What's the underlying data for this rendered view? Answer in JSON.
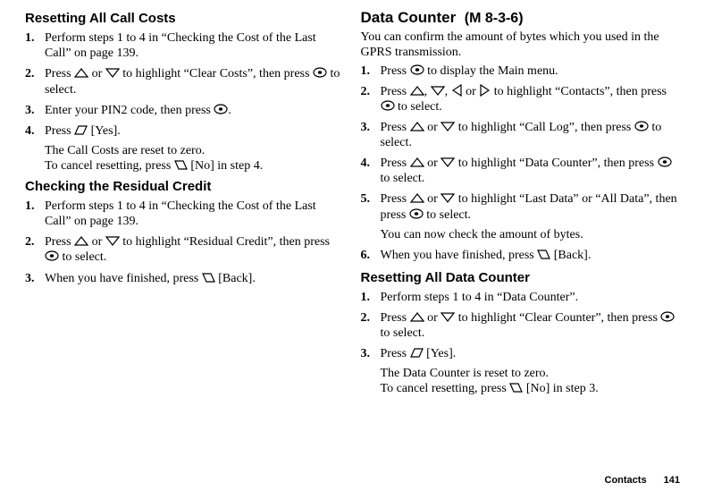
{
  "left": {
    "h1": "Resetting All Call Costs",
    "s1_1": "Perform steps 1 to 4 in “Checking the Cost of the Last Call” on page 139.",
    "s1_2a": "Press ",
    "s1_2b": " or ",
    "s1_2c": " to highlight “Clear Costs”, then press ",
    "s1_2d": " to select.",
    "s1_3a": "Enter your PIN2 code, then press ",
    "s1_3b": ".",
    "s1_4a": "Press ",
    "s1_4b": " [Yes].",
    "n1a": "The Call Costs are reset to zero.",
    "n1b": "To cancel resetting, press ",
    "n1c": " [No] in step 4.",
    "h2": "Checking the Residual Credit",
    "s2_1": "Perform steps 1 to 4 in “Checking the Cost of the Last Call” on page 139.",
    "s2_2a": "Press ",
    "s2_2b": " or ",
    "s2_2c": " to highlight “Residual Credit”, then press ",
    "s2_2d": " to select.",
    "s2_3a": "When you have finished, press ",
    "s2_3b": " [Back]."
  },
  "right": {
    "h1": "Data Counter",
    "h1s": "(M 8-3-6)",
    "intro": "You can confirm the amount of bytes which you used in the GPRS transmission.",
    "s1_1a": "Press ",
    "s1_1b": " to display the Main menu.",
    "s1_2a": "Press ",
    "s1_2b": ", ",
    "s1_2c": ", ",
    "s1_2d": " or ",
    "s1_2e": " to highlight “Contacts”, then press ",
    "s1_2f": " to select.",
    "s1_3a": "Press ",
    "s1_3b": " or ",
    "s1_3c": " to highlight “Call Log”, then press ",
    "s1_3d": " to select.",
    "s1_4a": "Press ",
    "s1_4b": " or ",
    "s1_4c": " to highlight “Data Counter”, then press ",
    "s1_4d": " to select.",
    "s1_5a": "Press ",
    "s1_5b": " or ",
    "s1_5c": " to highlight “Last Data” or “All Data”, then press ",
    "s1_5d": " to select.",
    "n1": "You can now check the amount of bytes.",
    "s1_6a": "When you have finished, press ",
    "s1_6b": " [Back].",
    "h2": "Resetting All Data Counter",
    "s2_1": "Perform steps 1 to 4 in “Data Counter”.",
    "s2_2a": "Press ",
    "s2_2b": " or ",
    "s2_2c": " to highlight “Clear Counter”, then press ",
    "s2_2d": " to select.",
    "s2_3a": "Press ",
    "s2_3b": " [Yes].",
    "n2a": "The Data Counter is reset to zero.",
    "n2b": "To cancel resetting, press ",
    "n2c": " [No] in step 3."
  },
  "footer": {
    "label": "Contacts",
    "page": "141"
  },
  "num": {
    "1": "1.",
    "2": "2.",
    "3": "3.",
    "4": "4.",
    "5": "5.",
    "6": "6."
  }
}
